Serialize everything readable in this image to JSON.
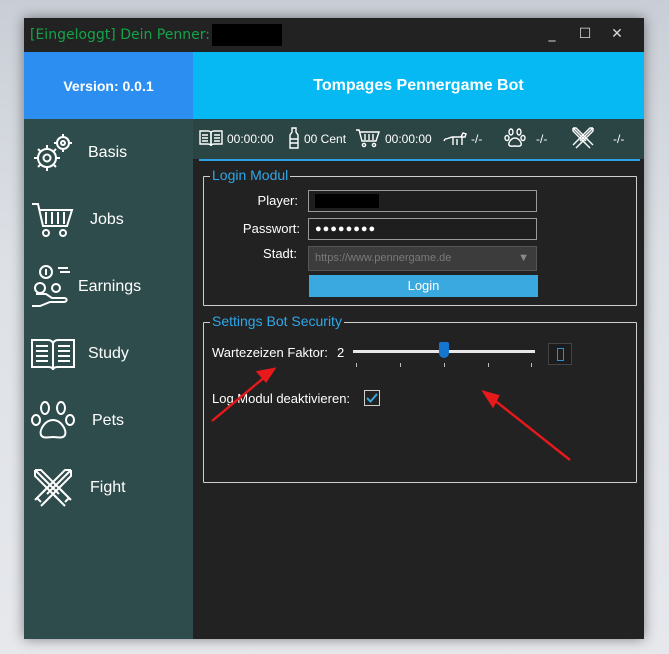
{
  "window": {
    "title_prefix": "[Eingeloggt] Dein Penner:",
    "controls": {
      "minimize": "_",
      "maximize": "☐",
      "close": "✕"
    }
  },
  "header": {
    "version": "Version: 0.0.1",
    "title": "Tompages Pennergame Bot"
  },
  "sidebar": {
    "items": [
      {
        "label": "Basis",
        "icon": "gears-icon"
      },
      {
        "label": "Jobs",
        "icon": "cart-icon"
      },
      {
        "label": "Earnings",
        "icon": "money-hand-icon"
      },
      {
        "label": "Study",
        "icon": "book-icon"
      },
      {
        "label": "Pets",
        "icon": "paw-icon"
      },
      {
        "label": "Fight",
        "icon": "swords-icon"
      }
    ]
  },
  "statusbar": {
    "study_time": "00:00:00",
    "money": "00 Cent",
    "jobs_time": "00:00:00",
    "dog_value": "-/-",
    "pets_value": "-/-",
    "fight_value": "-/-"
  },
  "login": {
    "group_title": "Login Modul",
    "player_label": "Player:",
    "password_label": "Passwort:",
    "password_value": "●●●●●●●●",
    "city_label": "Stadt:",
    "city_value": "https://www.pennergame.de",
    "login_button": "Login"
  },
  "security": {
    "group_title": "Settings Bot Security",
    "wait_label": "Wartezeizen Faktor:",
    "wait_value": "2",
    "slider_fraction": 0.5,
    "log_label": "Log Modul deaktivieren:",
    "log_checked": true
  },
  "colors": {
    "accent_blue": "#06b9f2",
    "version_blue": "#2c8ef1",
    "sidebar": "#2f4c4c",
    "title_green": "#13a44a",
    "arrow_red": "#e8191b"
  }
}
